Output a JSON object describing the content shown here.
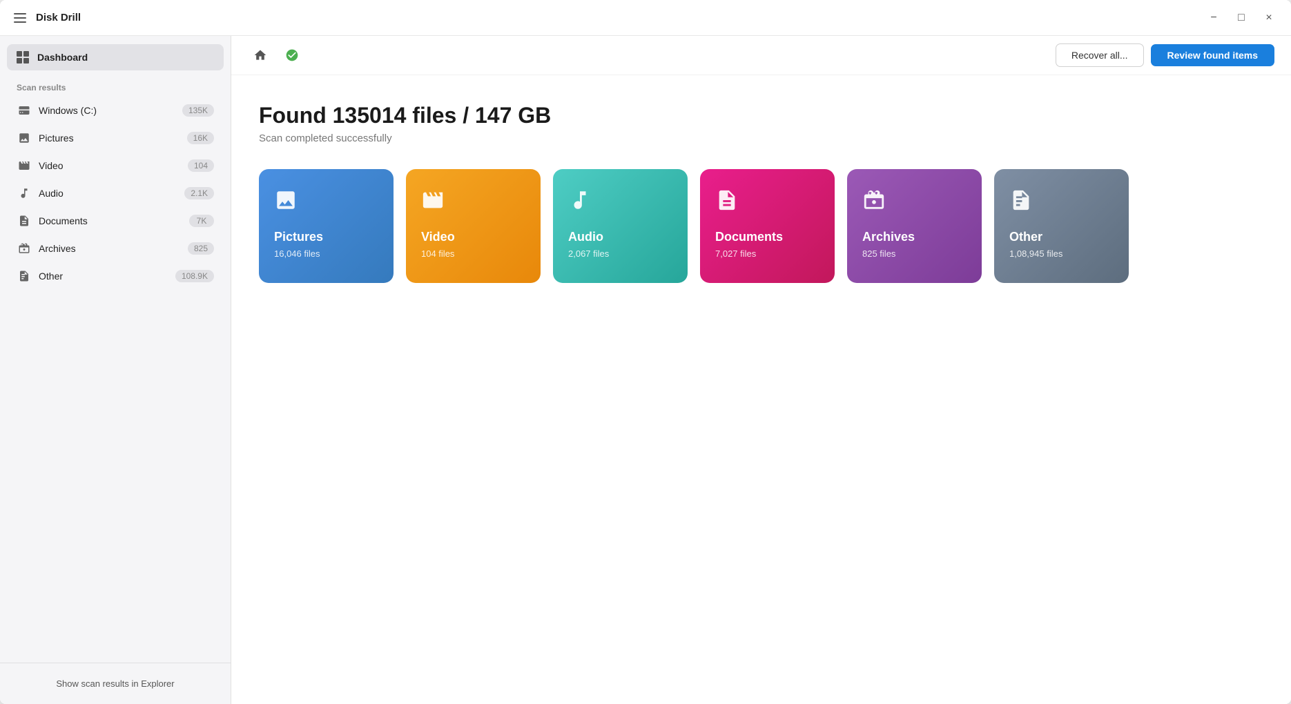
{
  "window": {
    "title": "Disk Drill"
  },
  "titlebar": {
    "hamburger_label": "menu",
    "minimize_label": "−",
    "maximize_label": "□",
    "close_label": "×"
  },
  "sidebar": {
    "dashboard_label": "Dashboard",
    "scan_results_heading": "Scan results",
    "items": [
      {
        "id": "windows",
        "name": "Windows (C:)",
        "count": "135K",
        "icon": "hdd"
      },
      {
        "id": "pictures",
        "name": "Pictures",
        "count": "16K",
        "icon": "pictures"
      },
      {
        "id": "video",
        "name": "Video",
        "count": "104",
        "icon": "video"
      },
      {
        "id": "audio",
        "name": "Audio",
        "count": "2.1K",
        "icon": "audio"
      },
      {
        "id": "documents",
        "name": "Documents",
        "count": "7K",
        "icon": "documents"
      },
      {
        "id": "archives",
        "name": "Archives",
        "count": "825",
        "icon": "archives"
      },
      {
        "id": "other",
        "name": "Other",
        "count": "108.9K",
        "icon": "other"
      }
    ],
    "footer_btn": "Show scan results in Explorer"
  },
  "toolbar": {
    "recover_all_label": "Recover all...",
    "review_found_label": "Review found items"
  },
  "content": {
    "heading": "Found 135014 files / 147 GB",
    "status": "Scan completed successfully",
    "categories": [
      {
        "id": "pictures",
        "name": "Pictures",
        "count": "16,046 files",
        "css_class": "cat-pictures"
      },
      {
        "id": "video",
        "name": "Video",
        "count": "104 files",
        "css_class": "cat-video"
      },
      {
        "id": "audio",
        "name": "Audio",
        "count": "2,067 files",
        "css_class": "cat-audio"
      },
      {
        "id": "documents",
        "name": "Documents",
        "count": "7,027 files",
        "css_class": "cat-documents"
      },
      {
        "id": "archives",
        "name": "Archives",
        "count": "825 files",
        "css_class": "cat-archives"
      },
      {
        "id": "other",
        "name": "Other",
        "count": "1,08,945 files",
        "css_class": "cat-other"
      }
    ]
  }
}
